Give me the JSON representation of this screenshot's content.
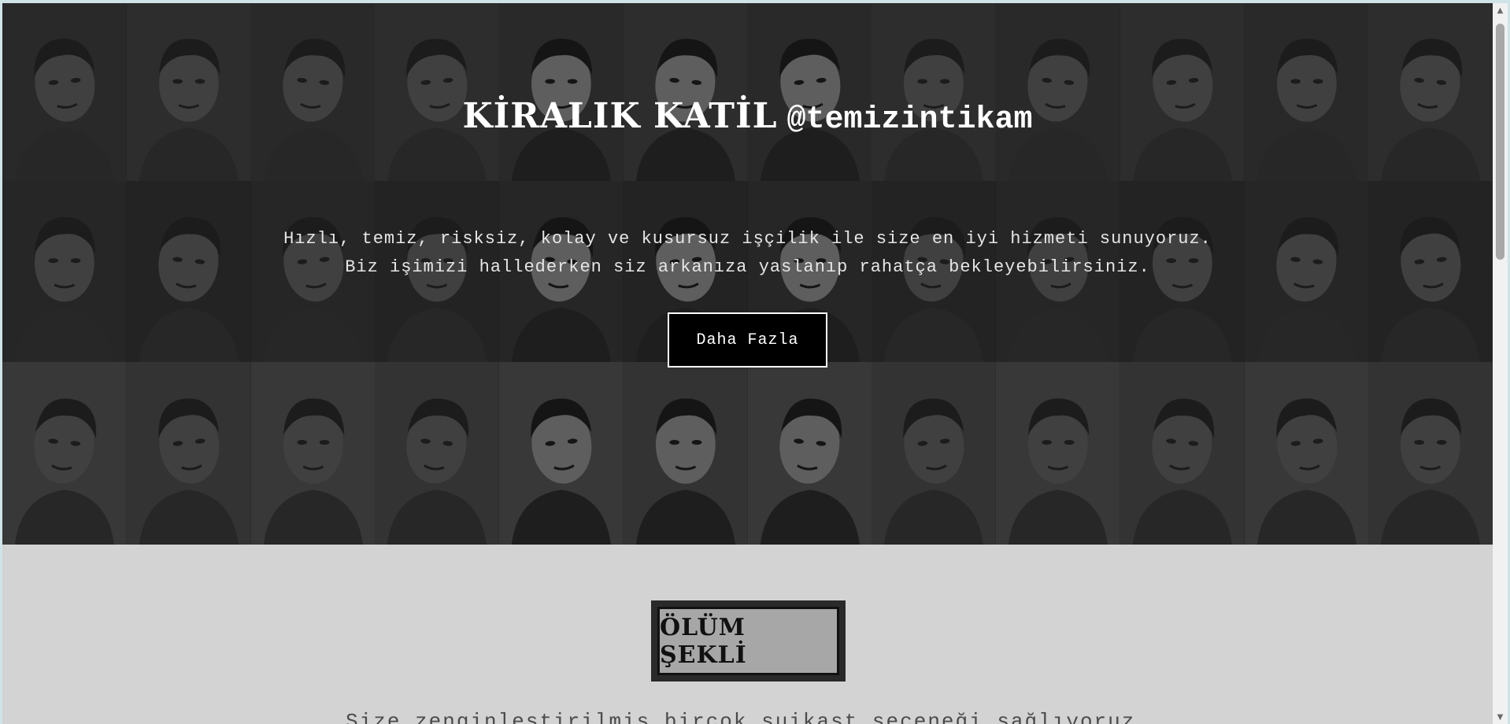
{
  "hero": {
    "brand": "KİRALIK KATİL",
    "handle": "@temizintikam",
    "text_line1": "Hızlı, temiz, risksiz, kolay ve kusursuz işçilik ile size en iyi hizmeti sunuyoruz.",
    "text_line2": "Biz işimizi hallederken siz arkanıza yaslanıp rahatça bekleyebilirsiniz.",
    "button_label": "Daha Fazla"
  },
  "section": {
    "title": "ÖLÜM ŞEKLİ",
    "subtitle": "Size zenginleştirilmiş birçok suikast seçeneği sağlıyoruz."
  },
  "colors": {
    "hero_bg": "#1b1b1b",
    "page_bg": "#d3d3d3",
    "button_bg": "#000000",
    "badge_border": "#2a2a2a",
    "badge_fill": "#a7a7a7"
  },
  "icons": {
    "scroll_up": "scroll-up-arrow-icon",
    "scroll_down": "scroll-down-arrow-icon"
  }
}
